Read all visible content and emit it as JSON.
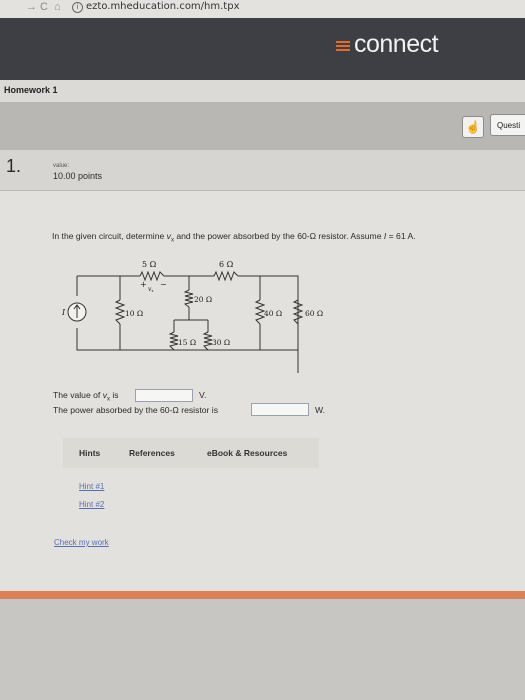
{
  "browser": {
    "back_glyph": "→",
    "reload_glyph": "C",
    "home_glyph": "⌂",
    "info_glyph": "i",
    "url": "ezto.mheducation.com/hm.tpx"
  },
  "header": {
    "brand": "connect"
  },
  "assignment": {
    "title": "Homework 1"
  },
  "toolbar": {
    "question_tab": "Questi"
  },
  "question": {
    "number": "1.",
    "value_caption": "value:",
    "points": "10.00 points",
    "prompt_pre": "In the given circuit, determine ",
    "prompt_var": "v",
    "prompt_sub": "x",
    "prompt_mid": " and the power absorbed by the 60-Ω resistor. Assume ",
    "prompt_i": "I",
    "prompt_post": " = 61 A."
  },
  "circuit": {
    "source_label": "I",
    "vx_label": "v",
    "vx_sub": "x",
    "plus": "+",
    "minus": "−",
    "r_top1": "5 Ω",
    "r_top2": "6 Ω",
    "r_left": "10 Ω",
    "r_mid": "20 Ω",
    "r_bottom1": "15 Ω",
    "r_bottom2": "30 Ω",
    "r_right1": "40 Ω",
    "r_right2": "60 Ω"
  },
  "answers": {
    "vx_prefix": "The value of ",
    "vx_var": "v",
    "vx_sub": "x",
    "vx_suffix": " is",
    "vx_value": "",
    "vx_unit": "V.",
    "power_label": "The power absorbed by the 60-Ω resistor is",
    "power_value": "",
    "power_unit": "W."
  },
  "tabs": [
    "Hints",
    "References",
    "eBook & Resources"
  ],
  "hints": [
    "Hint #1",
    "Hint #2"
  ],
  "check_work": "Check my work",
  "colors": {
    "header_bg": "#3d3f44",
    "brand_accent": "#e46a2b",
    "footer_stripe": "#d9825a",
    "link": "#5a6fb3"
  }
}
